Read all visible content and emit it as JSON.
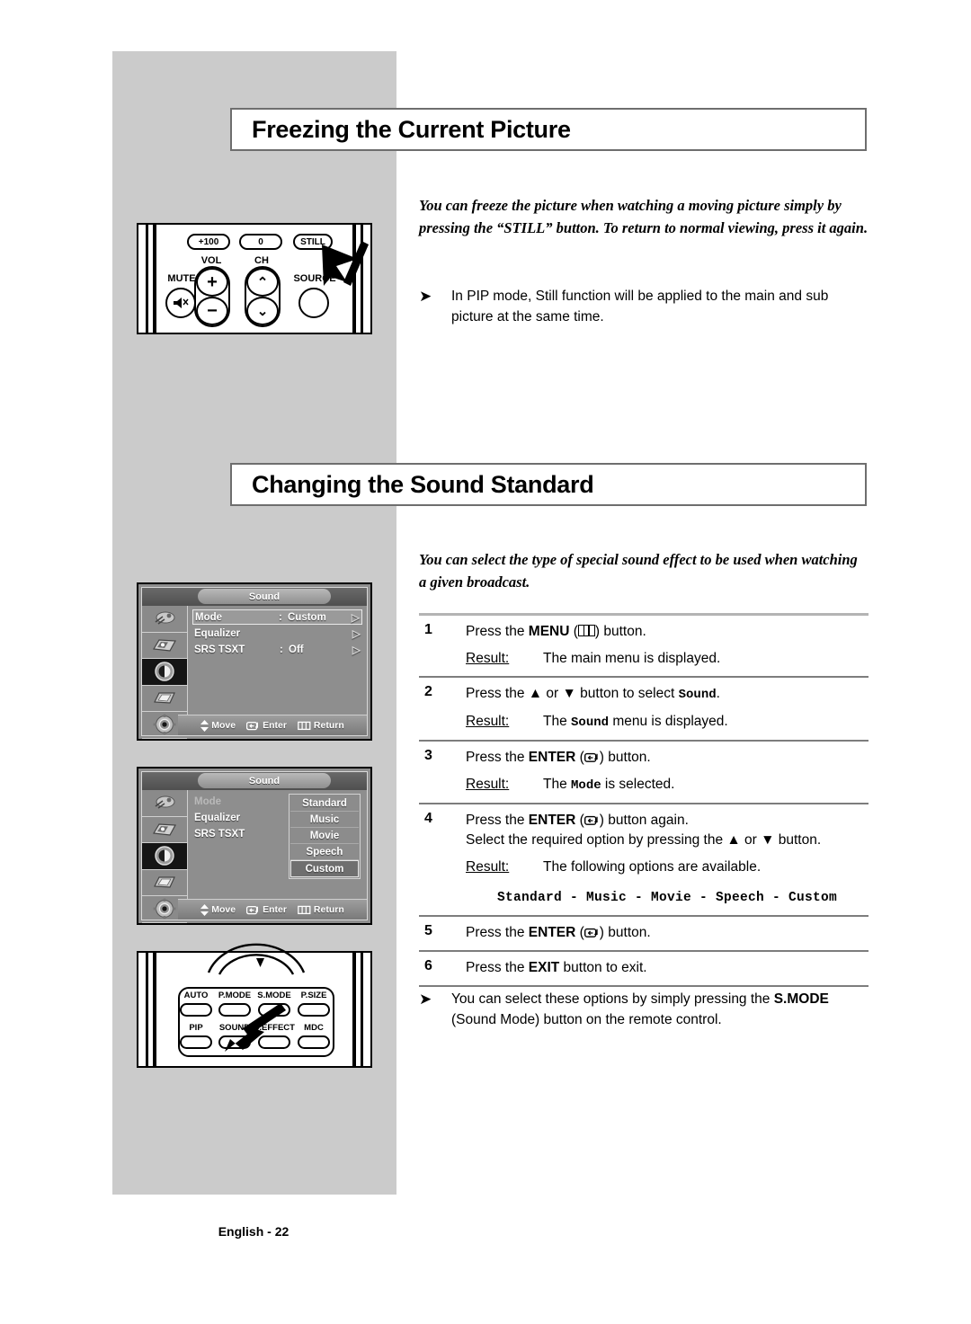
{
  "page": {
    "footer_label": "English - 22",
    "bg_gray": "#cbcbcb"
  },
  "section1": {
    "heading": "Freezing the Current Picture",
    "intro": "You can freeze the picture when watching a moving picture simply by pressing the “STILL” button. To return to normal viewing, press it again.",
    "note_arrow": "➤",
    "note": "In PIP mode, Still function will be applied to the main and sub picture at the same time.",
    "remote": {
      "pill_plus100": "+100",
      "pill_zero": "0",
      "pill_still": "STILL",
      "label_vol": "VOL",
      "label_ch": "CH",
      "label_mute": "MUTE",
      "label_source": "SOURCE",
      "vol_up": "+",
      "vol_down": "−",
      "ch_up": "⌃",
      "ch_down": "⌄"
    }
  },
  "section2": {
    "heading": "Changing the Sound Standard",
    "intro": "You can select the type of special sound effect to be used when watching a given broadcast.",
    "note_arrow": "➤",
    "note_part1": "You can select these options by simply pressing the ",
    "note_bold": "S.MODE",
    "note_part2": " (Sound Mode) button on the remote control.",
    "steps": [
      {
        "num": "1",
        "text_before": "Press the ",
        "key": "MENU",
        "key_glyph": "menu-icon",
        "text_after": " button.",
        "result_label": "Result:",
        "result_before": "The main menu is displayed.",
        "result_mono": "",
        "result_after": ""
      },
      {
        "num": "2",
        "text_before": "Press the ▲ or ▼ button to select ",
        "key": "",
        "key_glyph": "",
        "text_mono": "Sound",
        "text_after": ".",
        "result_label": "Result:",
        "result_before": "The ",
        "result_mono": "Sound",
        "result_after": " menu is displayed."
      },
      {
        "num": "3",
        "text_before": "Press the ",
        "key": "ENTER",
        "key_glyph": "enter-icon",
        "text_after": " button.",
        "result_label": "Result:",
        "result_before": "The ",
        "result_mono": "Mode",
        "result_after": " is selected."
      },
      {
        "num": "4",
        "text_before": "Press the ",
        "key": "ENTER",
        "key_glyph": "enter-icon",
        "text_after": " button again.",
        "text_line2": "Select the required option by pressing the ▲ or ▼ button.",
        "result_label": "Result:",
        "result_before": "The following options are available.",
        "result_mono": "",
        "result_after": "",
        "options_line": "Standard - Music - Movie - Speech  - Custom"
      },
      {
        "num": "5",
        "text_before": "Press the ",
        "key": "ENTER",
        "key_glyph": "enter-icon",
        "text_after": " button.",
        "result_label": "",
        "result_before": "",
        "result_mono": "",
        "result_after": ""
      },
      {
        "num": "6",
        "text_before": "Press the ",
        "key": "EXIT",
        "key_glyph": "",
        "text_after": " button to exit.",
        "result_label": "",
        "result_before": "",
        "result_mono": "",
        "result_after": ""
      }
    ],
    "osd1": {
      "title": "Sound",
      "rows": [
        {
          "label": "Mode",
          "colon": ":",
          "value": "Custom",
          "arrow": "▷",
          "selected": true
        },
        {
          "label": "Equalizer",
          "colon": "",
          "value": "",
          "arrow": "▷",
          "selected": false
        },
        {
          "label": "SRS TSXT",
          "colon": ":",
          "value": "Off",
          "arrow": "▷",
          "selected": false
        }
      ],
      "bottom": {
        "move": "Move",
        "enter": "Enter",
        "return": "Return"
      }
    },
    "osd2": {
      "title": "Sound",
      "rows": [
        {
          "label": "Mode",
          "colon": ":",
          "value": "",
          "arrow": "",
          "selected": false,
          "dim": true
        },
        {
          "label": "Equalizer",
          "colon": "",
          "value": "",
          "arrow": "",
          "selected": false,
          "dim": false
        },
        {
          "label": "SRS TSXT",
          "colon": ":",
          "value": "",
          "arrow": "",
          "selected": false,
          "dim": false
        }
      ],
      "dropdown": [
        {
          "label": "Standard",
          "selected": false
        },
        {
          "label": "Music",
          "selected": false
        },
        {
          "label": "Movie",
          "selected": false
        },
        {
          "label": "Speech",
          "selected": false
        },
        {
          "label": "Custom",
          "selected": true
        }
      ],
      "bottom": {
        "move": "Move",
        "enter": "Enter",
        "return": "Return"
      }
    },
    "remote_bottom": {
      "buttons_row1": [
        "AUTO",
        "P.MODE",
        "S.MODE",
        "P.SIZE"
      ],
      "buttons_row2": [
        "PIP",
        "SOUND",
        "S.EFFECT",
        "MDC"
      ]
    }
  }
}
